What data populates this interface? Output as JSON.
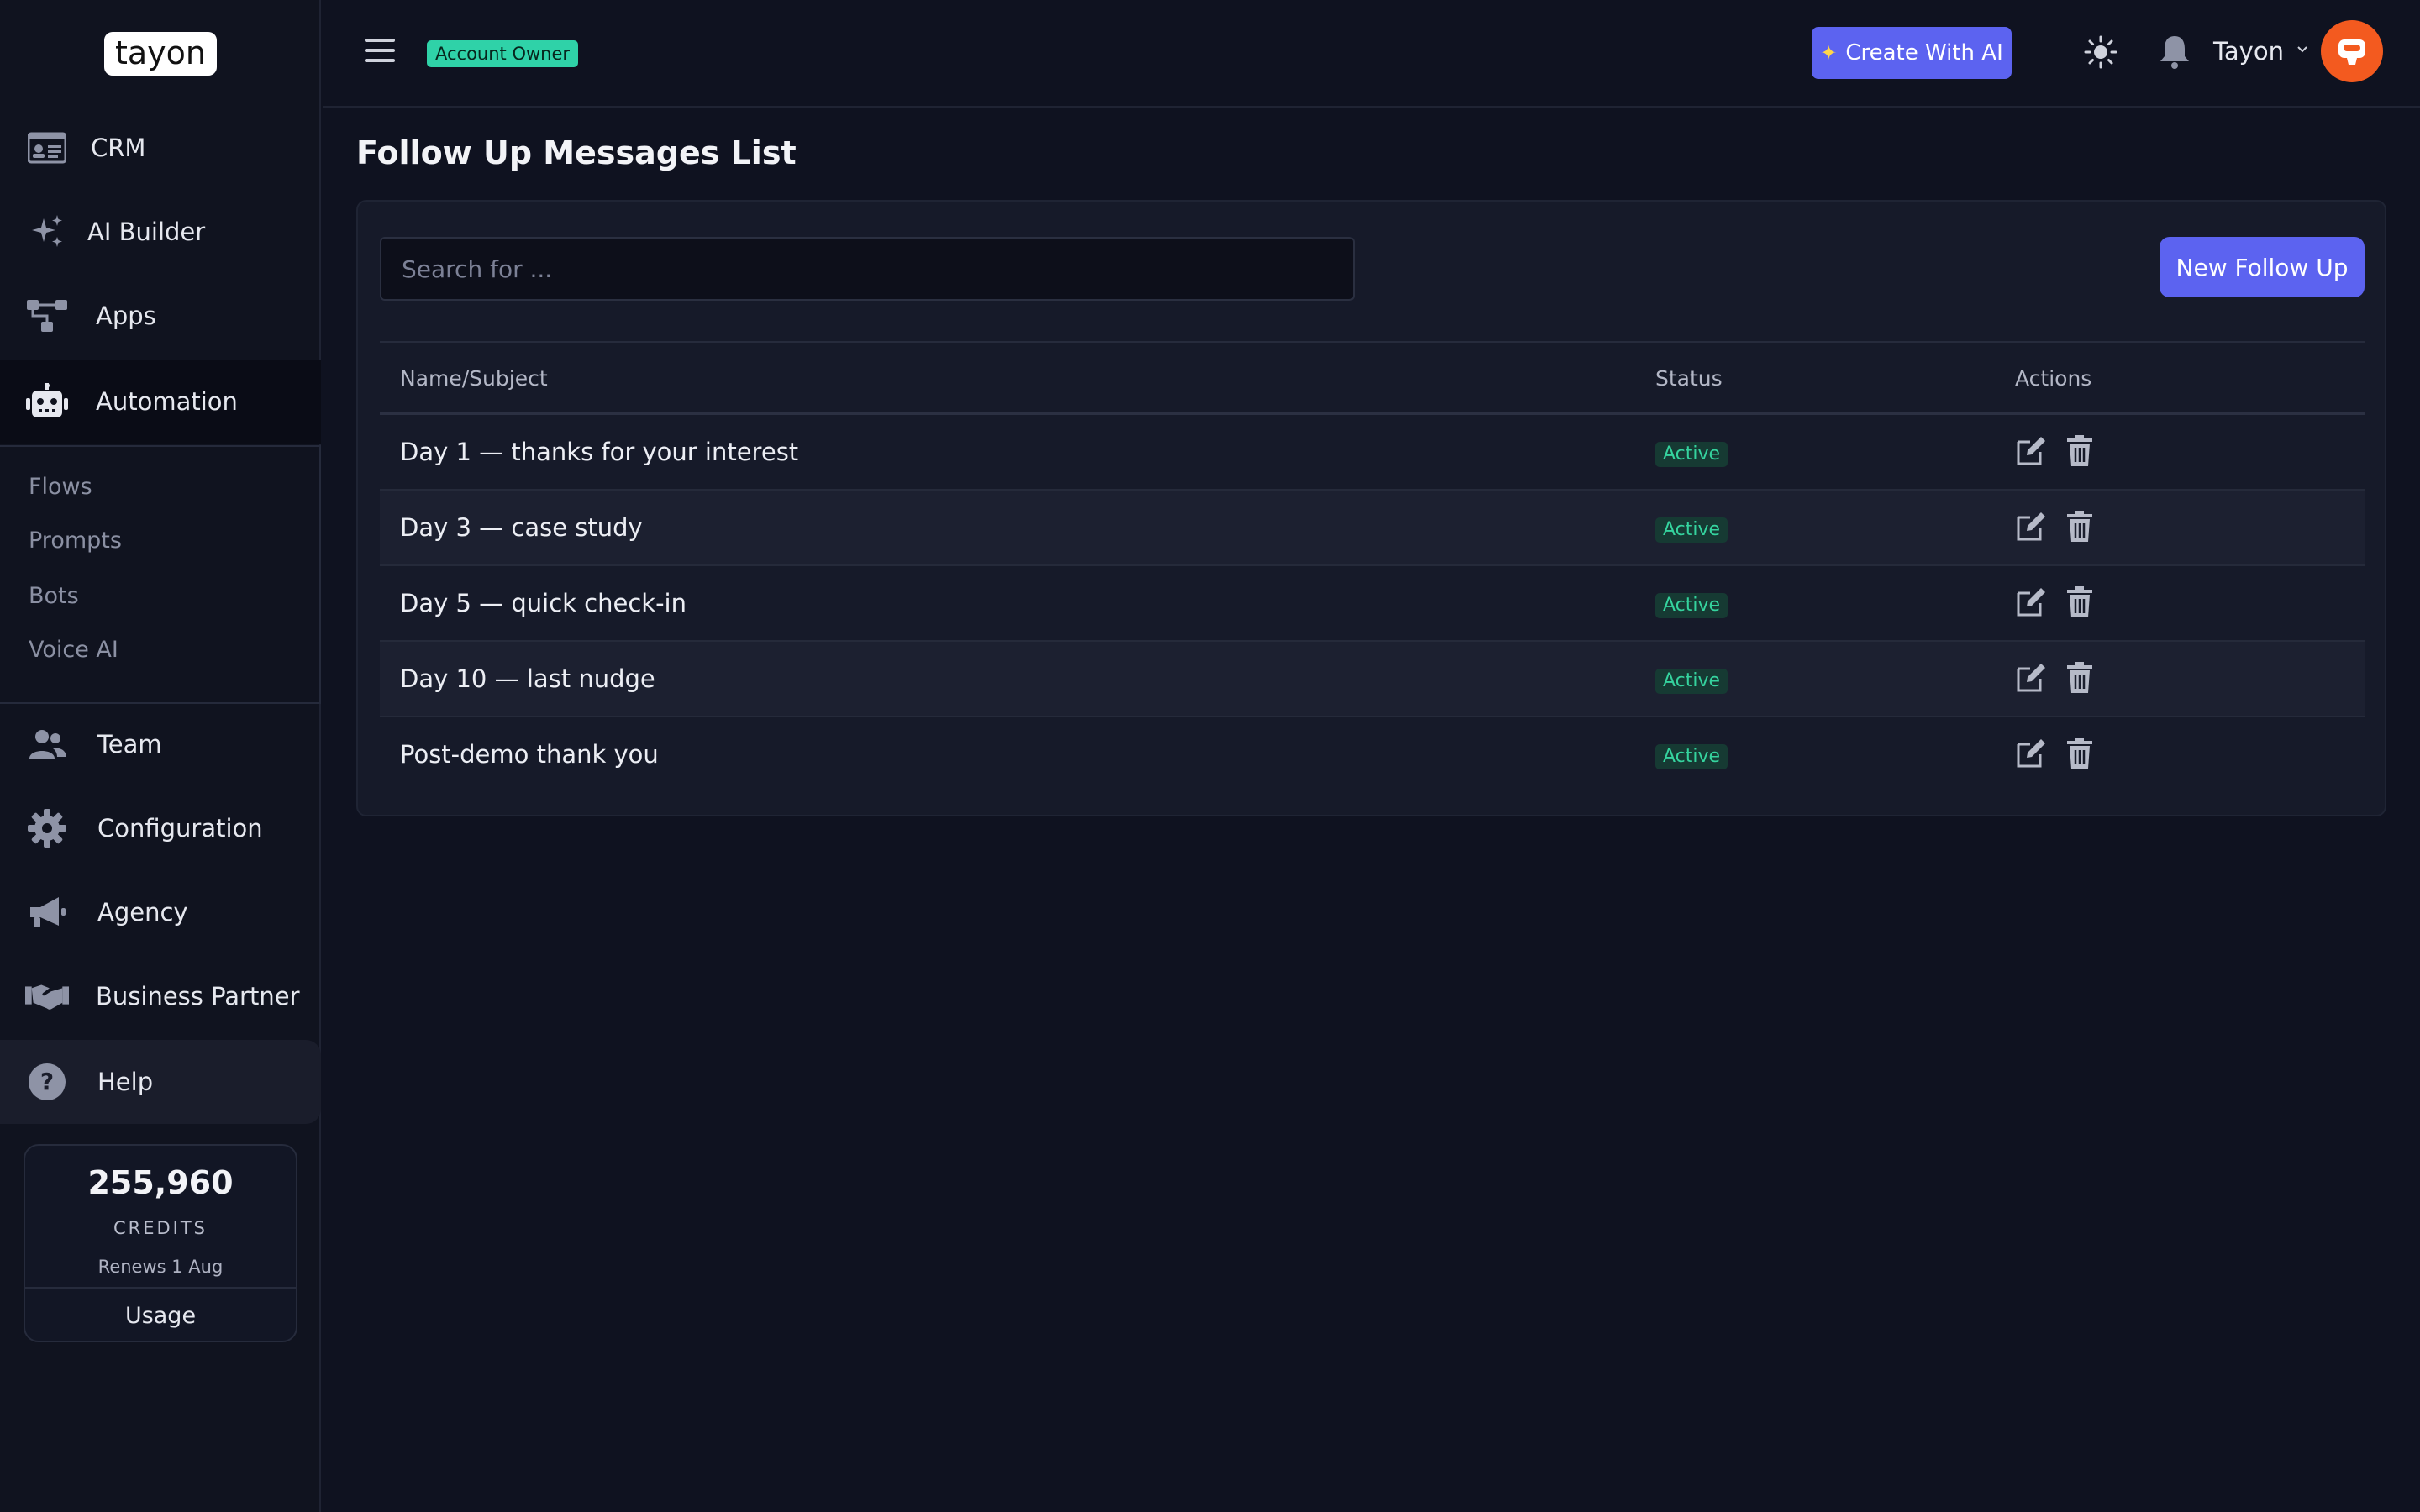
{
  "app": {
    "logo_text": "tayon"
  },
  "sidebar": {
    "items": [
      {
        "label": "CRM",
        "icon": "id-card-icon"
      },
      {
        "label": "AI Builder",
        "icon": "sparkles-icon"
      },
      {
        "label": "Apps",
        "icon": "sitemap-icon"
      },
      {
        "label": "Automation",
        "icon": "robot-icon"
      },
      {
        "label": "Team",
        "icon": "users-icon"
      },
      {
        "label": "Configuration",
        "icon": "gear-icon"
      },
      {
        "label": "Agency",
        "icon": "megaphone-icon"
      },
      {
        "label": "Business Partner",
        "icon": "handshake-icon"
      },
      {
        "label": "Help",
        "icon": "question-circle-icon"
      }
    ],
    "automation_submenu": [
      "Flows",
      "Prompts",
      "Bots",
      "Voice AI"
    ],
    "credits": {
      "amount": "255,960",
      "caption": "CREDITS",
      "renews": "Renews 1 Aug",
      "usage_label": "Usage"
    }
  },
  "header": {
    "role_badge": "Account Owner",
    "create_ai_label": "Create With AI",
    "user_name": "Tayon"
  },
  "main": {
    "title": "Follow Up Messages List",
    "search_placeholder": "Search for ...",
    "new_button": "New Follow Up",
    "columns": [
      "Name/Subject",
      "Status",
      "Actions"
    ],
    "rows": [
      {
        "name": "Day 1 — thanks for your interest",
        "status": "Active"
      },
      {
        "name": "Day 3 — case study",
        "status": "Active"
      },
      {
        "name": "Day 5 — quick check-in",
        "status": "Active"
      },
      {
        "name": "Day 10 — last nudge",
        "status": "Active"
      },
      {
        "name": "Post-demo thank you",
        "status": "Active"
      }
    ]
  },
  "colors": {
    "accent": "#5c63f0",
    "success": "#35d39e",
    "owner_badge": "#2fd2a8",
    "avatar": "#f35a1f"
  }
}
